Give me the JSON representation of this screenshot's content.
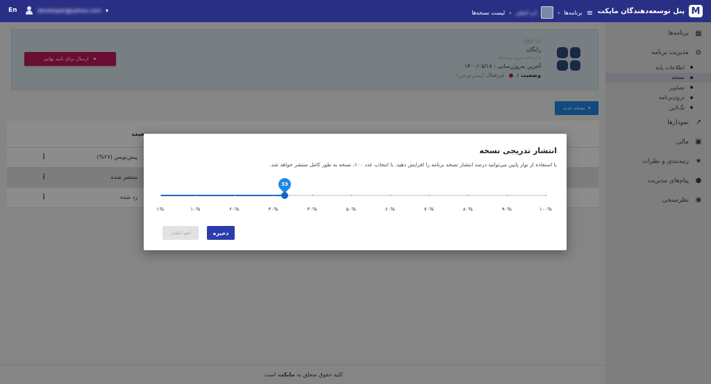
{
  "topbar": {
    "brand_title": "پنل توسعه‌دهندگان مایکت",
    "brand_logo": "M",
    "menu_icon": "menu-icon",
    "breadcrumb": {
      "programs": "برنامه‌ها",
      "app_name": "اپ اصلی",
      "versions_list": "لیست نسخه‌ها"
    },
    "user_email": "developer@yahoo.com",
    "language": "En"
  },
  "sidebar": {
    "items_top": [
      {
        "label": "برنامه‌ها",
        "icon": "grid-icon",
        "glyph": "▦"
      },
      {
        "label": "مدیریت برنامه",
        "icon": "gear-icon",
        "glyph": "⚙"
      }
    ],
    "subitems": [
      {
        "label": "اطلاعات پایه"
      },
      {
        "label": "نسخه"
      },
      {
        "label": "تصاویر"
      },
      {
        "label": "درون‌برنامه"
      },
      {
        "label": "تگ‌لاین"
      }
    ],
    "items_bottom": [
      {
        "label": "نمودارها",
        "icon": "chart-icon",
        "glyph": "📈"
      },
      {
        "label": "مالی",
        "icon": "money-icon",
        "glyph": "▣"
      },
      {
        "label": "رتبه‌بندی و نظرات",
        "icon": "star-icon",
        "glyph": "★"
      },
      {
        "label": "پیام‌های مدیریت",
        "icon": "chat-icon",
        "glyph": "💬"
      },
      {
        "label": "نظرسنجی",
        "icon": "eye-icon",
        "glyph": "◉"
      }
    ]
  },
  "app_card": {
    "app_name": "اپ اصلی",
    "price": "رایگان",
    "iap_note": "با پرداخت درون برنامه‌ای",
    "last_update_label": "آخرین به‌روزرسانی :",
    "last_update_value": "۱۴۰۰/۰۵/۱۸",
    "status_label": "وضعیت :",
    "status_value": "غیرفعال",
    "status_detail": "(پیش‌نویس)",
    "status_color": "#c2185b",
    "send_button": "ارسال برای تایید نهایی"
  },
  "new_version_button": "نسخه جدید",
  "table": {
    "header_status": "وضعیت",
    "rows": [
      {
        "status": "پیش‌نویس (۲۷%)"
      },
      {
        "status": "منتشر شده"
      },
      {
        "status": "رد شده"
      }
    ],
    "kebab": "⋮"
  },
  "footer": {
    "prefix": "کلیه حقوق متعلق به",
    "brand": "مایکت",
    "suffix": "است."
  },
  "modal": {
    "title": "انتشار تدریجی نسخه",
    "description": "با استفاده از نوار پایین می‌توانید درصد انتشار نسخه برنامه را افزایش دهید. با انتخاب عدد ۱۰۰، نسخه به طور کامل منتشر خواهد شد.",
    "slider_value": 33,
    "slider_bubble": "33",
    "tick_labels": [
      "۱%",
      "۱۰%",
      "۲۰%",
      "۳۰%",
      "۴۰%",
      "۵۰%",
      "۶۰%",
      "۷۰%",
      "۸۰%",
      "۹۰%",
      "۱۰۰%"
    ],
    "save_button": "ذخیره",
    "cancel_button": "لغو انتشار",
    "accent_color": "#1565c0"
  }
}
